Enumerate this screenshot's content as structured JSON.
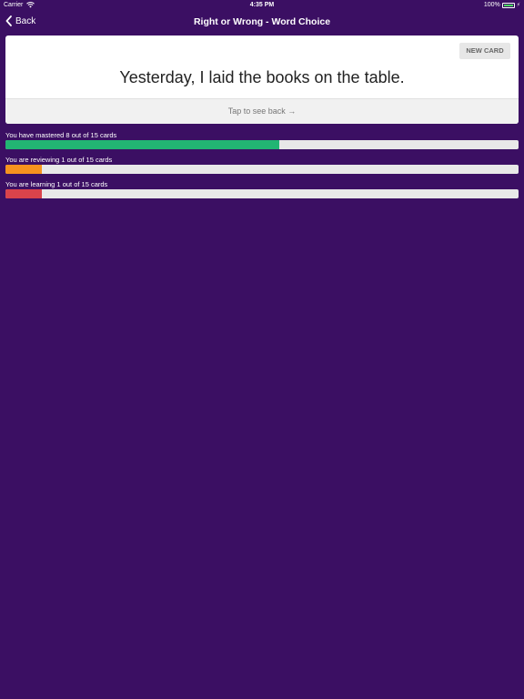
{
  "status": {
    "carrier": "Carrier",
    "time": "4:35 PM",
    "battery": "100%"
  },
  "nav": {
    "back_label": "Back",
    "title": "Right or Wrong - Word Choice"
  },
  "card": {
    "new_card_label": "NEW CARD",
    "front_text": "Yesterday, I laid the books on the table.",
    "tap_label": "Tap to see back"
  },
  "progress": [
    {
      "label": "You have mastered 8 out of 15 cards",
      "fraction": 0.533,
      "color": "#22b573"
    },
    {
      "label": "You are reviewing 1 out of 15 cards",
      "fraction": 0.0711,
      "color": "#f7931e"
    },
    {
      "label": "You are learning 1 out of 15 cards",
      "fraction": 0.0711,
      "color": "#d9434b"
    }
  ]
}
